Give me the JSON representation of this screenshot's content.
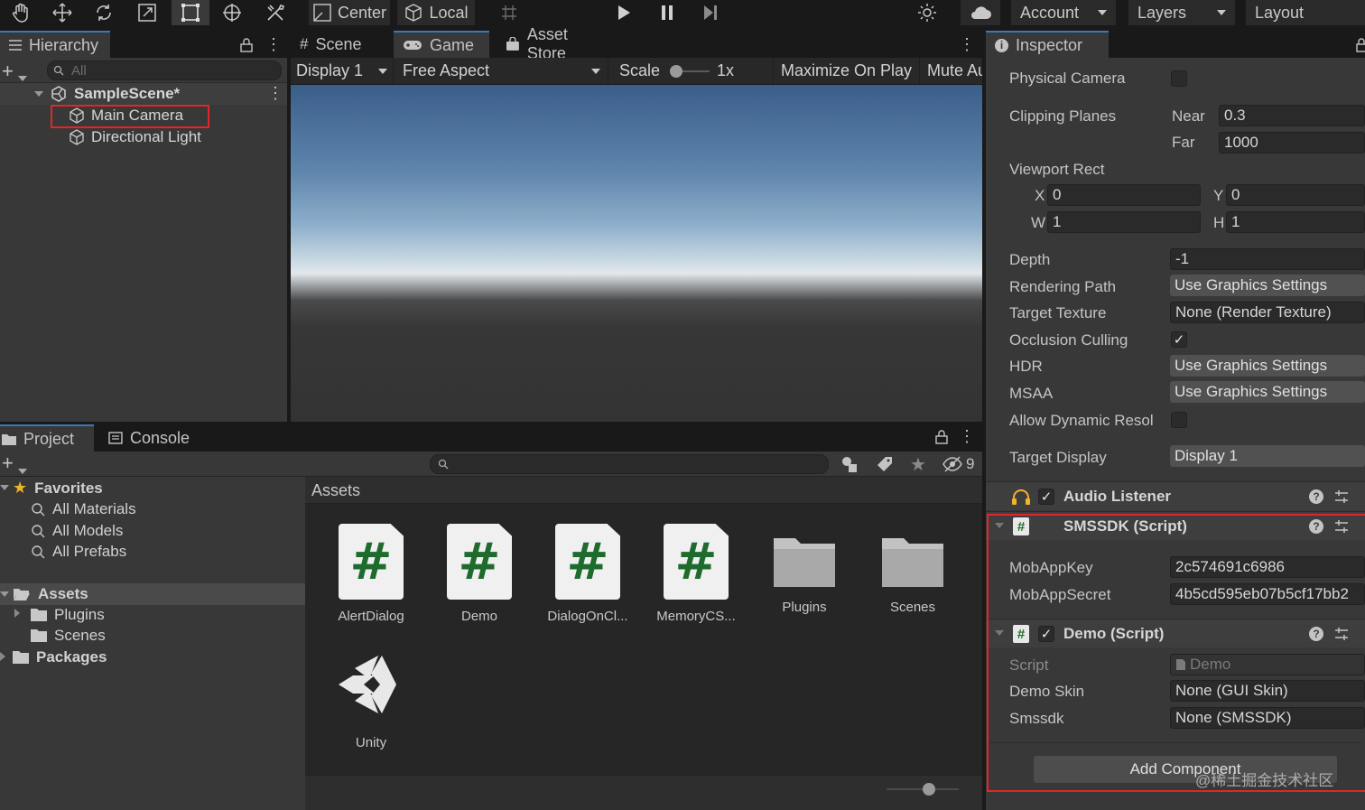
{
  "toolbar": {
    "pivot_label": "Center",
    "space_label": "Local",
    "account_label": "Account",
    "layers_label": "Layers",
    "layout_label": "Layout"
  },
  "hierarchy": {
    "tab_label": "Hierarchy",
    "search_placeholder": "All",
    "scene_name": "SampleScene*",
    "items": [
      {
        "label": "Main Camera"
      },
      {
        "label": "Directional Light"
      }
    ]
  },
  "game": {
    "tabs": [
      {
        "label": "Scene"
      },
      {
        "label": "Game"
      },
      {
        "label": "Asset Store"
      }
    ],
    "display": "Display 1",
    "aspect": "Free Aspect",
    "scale_label": "Scale",
    "scale_value": "1x",
    "maximize_label": "Maximize On Play",
    "mute_label": "Mute Au"
  },
  "project": {
    "tabs": [
      {
        "label": "Project"
      },
      {
        "label": "Console"
      }
    ],
    "hidden_count": "9",
    "favorites_label": "Favorites",
    "favorites": [
      "All Materials",
      "All Models",
      "All Prefabs"
    ],
    "assets_root": "Assets",
    "asset_folders": [
      "Plugins",
      "Scenes"
    ],
    "packages_label": "Packages",
    "breadcrumb": "Assets",
    "assets": [
      {
        "name": "AlertDialog",
        "kind": "script"
      },
      {
        "name": "Demo",
        "kind": "script"
      },
      {
        "name": "DialogOnCl...",
        "kind": "script"
      },
      {
        "name": "MemoryCS...",
        "kind": "script"
      },
      {
        "name": "Plugins",
        "kind": "folder"
      },
      {
        "name": "Scenes",
        "kind": "folder"
      },
      {
        "name": "Unity",
        "kind": "unity"
      }
    ]
  },
  "inspector": {
    "tab_label": "Inspector",
    "physical_camera": "Physical Camera",
    "clipping_planes": "Clipping Planes",
    "near_label": "Near",
    "near_value": "0.3",
    "far_label": "Far",
    "far_value": "1000",
    "viewport_rect": "Viewport Rect",
    "x_label": "X",
    "x_value": "0",
    "y_label": "Y",
    "y_value": "0",
    "w_label": "W",
    "w_value": "1",
    "h_label": "H",
    "h_value": "1",
    "depth_label": "Depth",
    "depth_value": "-1",
    "rendering_path_label": "Rendering Path",
    "rendering_path_value": "Use Graphics Settings",
    "target_texture_label": "Target Texture",
    "target_texture_value": "None (Render Texture)",
    "occlusion_label": "Occlusion Culling",
    "hdr_label": "HDR",
    "hdr_value": "Use Graphics Settings",
    "msaa_label": "MSAA",
    "msaa_value": "Use Graphics Settings",
    "dynamic_res_label": "Allow Dynamic Resol",
    "target_display_label": "Target Display",
    "target_display_value": "Display 1",
    "audio_listener": "Audio Listener",
    "smssdk_header": "SMSSDK (Script)",
    "mobappkey_label": "MobAppKey",
    "mobappkey_value": "2c574691c6986",
    "mobappsecret_label": "MobAppSecret",
    "mobappsecret_value": "4b5cd595eb07b5cf17bb2",
    "demo_header": "Demo (Script)",
    "script_label": "Script",
    "script_value": "Demo",
    "demo_skin_label": "Demo Skin",
    "demo_skin_value": "None (GUI Skin)",
    "smssdk_label": "Smssdk",
    "smssdk_value": "None (SMSSDK)",
    "add_component": "Add Component"
  },
  "watermark": "@稀土掘金技术社区",
  "colors": {
    "highlight_red": "#e0262a",
    "script_green": "#1f6b2e",
    "accent_blue": "#3a79bb"
  }
}
